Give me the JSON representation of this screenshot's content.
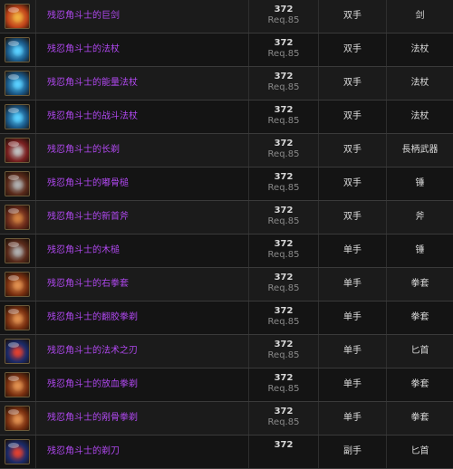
{
  "items": [
    {
      "name": "残忍角斗士的巨剑",
      "ilvl": "372",
      "req": "Req.85",
      "slot": "双手",
      "type": "剑",
      "icon": "sword-icon",
      "icon_color": "#c0441a",
      "core_color": "#f0b040"
    },
    {
      "name": "残忍角斗士的法杖",
      "ilvl": "372",
      "req": "Req.85",
      "slot": "双手",
      "type": "法杖",
      "icon": "staff-icon",
      "icon_color": "#1a5a8a",
      "core_color": "#5ad0ff"
    },
    {
      "name": "残忍角斗士的能量法杖",
      "ilvl": "372",
      "req": "Req.85",
      "slot": "双手",
      "type": "法杖",
      "icon": "staff-icon",
      "icon_color": "#1a5a8a",
      "core_color": "#5ad0ff"
    },
    {
      "name": "残忍角斗士的战斗法杖",
      "ilvl": "372",
      "req": "Req.85",
      "slot": "双手",
      "type": "法杖",
      "icon": "staff-icon",
      "icon_color": "#1a5a8a",
      "core_color": "#5ad0ff"
    },
    {
      "name": "残忍角斗士的长剃",
      "ilvl": "372",
      "req": "Req.85",
      "slot": "双手",
      "type": "長柄武器",
      "icon": "polearm-icon",
      "icon_color": "#7a2020",
      "core_color": "#c0c0c0"
    },
    {
      "name": "残忍角斗士的嘟骨槌",
      "ilvl": "372",
      "req": "Req.85",
      "slot": "双手",
      "type": "锤",
      "icon": "mace-icon",
      "icon_color": "#5a2a1a",
      "core_color": "#b0b0b0"
    },
    {
      "name": "残忍角斗士的新首斧",
      "ilvl": "372",
      "req": "Req.85",
      "slot": "双手",
      "type": "斧",
      "icon": "axe-icon",
      "icon_color": "#6a2a1a",
      "core_color": "#d08040"
    },
    {
      "name": "残忍角斗士的木槌",
      "ilvl": "372",
      "req": "Req.85",
      "slot": "单手",
      "type": "锤",
      "icon": "mace-icon",
      "icon_color": "#5a2a1a",
      "core_color": "#b0b0b0"
    },
    {
      "name": "残忍角斗士的右拳套",
      "ilvl": "372",
      "req": "Req.85",
      "slot": "单手",
      "type": "拳套",
      "icon": "fist-weapon-icon",
      "icon_color": "#7a3010",
      "core_color": "#e09050"
    },
    {
      "name": "残忍角斗士的翻胶拳剃",
      "ilvl": "372",
      "req": "Req.85",
      "slot": "单手",
      "type": "拳套",
      "icon": "fist-weapon-icon",
      "icon_color": "#7a3010",
      "core_color": "#e09050"
    },
    {
      "name": "残忍角斗士的法术之刃",
      "ilvl": "372",
      "req": "Req.85",
      "slot": "单手",
      "type": "匕首",
      "icon": "dagger-icon",
      "icon_color": "#1a2a6a",
      "core_color": "#e04030"
    },
    {
      "name": "残忍角斗士的放血拳剃",
      "ilvl": "372",
      "req": "Req.85",
      "slot": "单手",
      "type": "拳套",
      "icon": "fist-weapon-icon",
      "icon_color": "#7a3010",
      "core_color": "#e09050"
    },
    {
      "name": "残忍角斗士的剐骨拳剃",
      "ilvl": "372",
      "req": "Req.85",
      "slot": "单手",
      "type": "拳套",
      "icon": "fist-weapon-icon",
      "icon_color": "#7a3010",
      "core_color": "#e09050"
    },
    {
      "name": "残忍角斗士的剃刀",
      "ilvl": "372",
      "req": "",
      "slot": "副手",
      "type": "匕首",
      "icon": "dagger-icon",
      "icon_color": "#1a2a6a",
      "core_color": "#e04030"
    }
  ]
}
